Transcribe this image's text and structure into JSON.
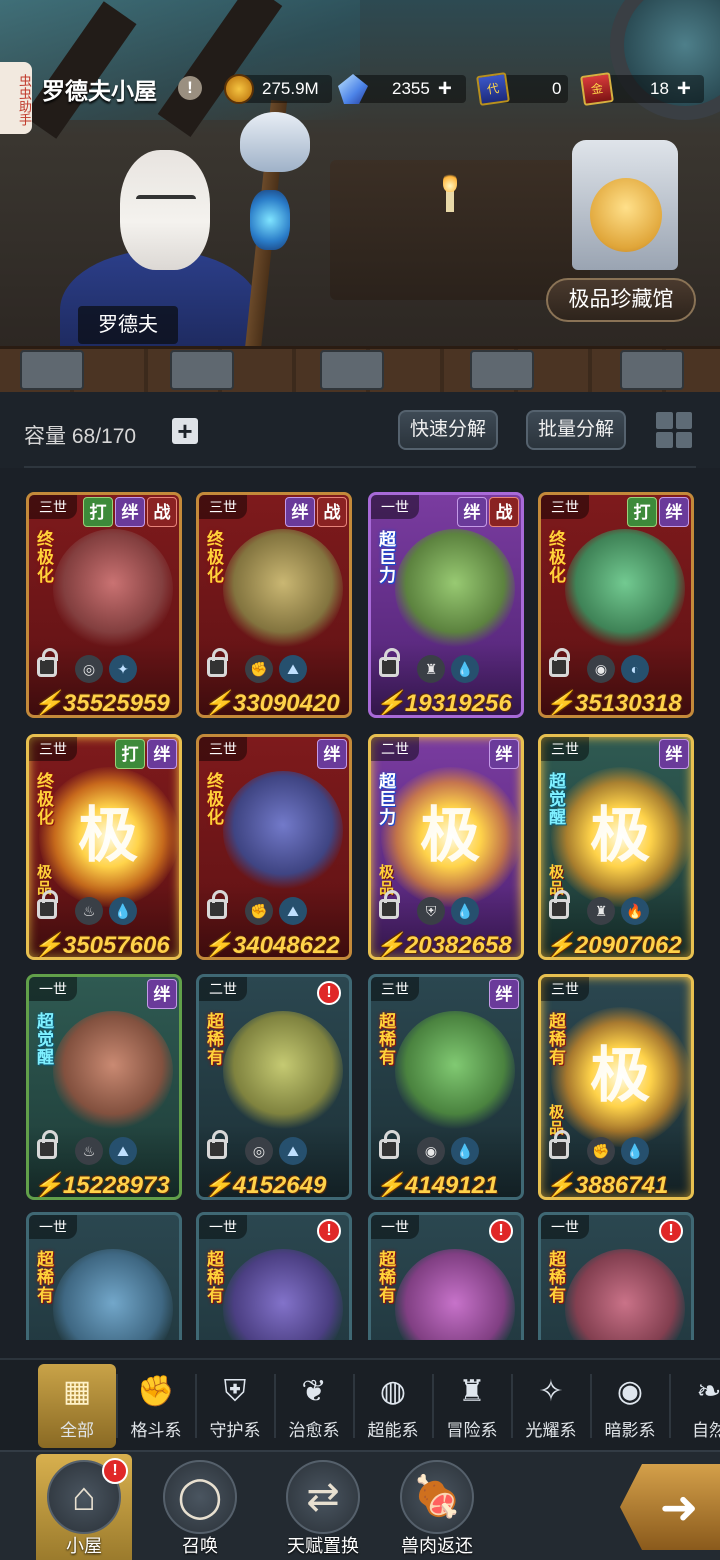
{
  "side_tab": "虫虫助手",
  "header": {
    "title": "罗德夫小屋",
    "info_icon": "!",
    "resources": [
      {
        "icon": "coin-icon",
        "value": "275.9M",
        "plus": false
      },
      {
        "icon": "crystal-icon",
        "value": "2355",
        "plus": true
      },
      {
        "icon": "blue-ticket-icon",
        "ticket_text": "代",
        "value": "0",
        "plus": false
      },
      {
        "icon": "red-ticket-icon",
        "ticket_text": "金",
        "value": "18",
        "plus": true
      }
    ]
  },
  "scene": {
    "npc_name": "罗德夫",
    "collection_button": "极品珍藏馆"
  },
  "storage": {
    "capacity_label": "容量",
    "capacity_value": "68/170",
    "quick_decompose": "快速分解",
    "batch_decompose": "批量分解"
  },
  "cards": [
    {
      "gen": "三世",
      "badges": [
        "打",
        "绊",
        "战"
      ],
      "rarity": "终极化",
      "power": "35525959",
      "elements": [
        "◎",
        "✦"
      ],
      "theme": "red",
      "ji": false,
      "alert": false
    },
    {
      "gen": "三世",
      "badges": [
        "绊",
        "战"
      ],
      "rarity": "终极化",
      "power": "33090420",
      "elements": [
        "✊",
        "⛰"
      ],
      "theme": "red",
      "ji": false,
      "alert": false
    },
    {
      "gen": "一世",
      "badges": [
        "绊",
        "战"
      ],
      "rarity": "超巨力",
      "power": "19319256",
      "elements": [
        "♜",
        "💧"
      ],
      "theme": "purple",
      "ji": false,
      "alert": false
    },
    {
      "gen": "三世",
      "badges": [
        "打",
        "绊"
      ],
      "rarity": "终极化",
      "power": "35130318",
      "elements": [
        "◉",
        "◐"
      ],
      "theme": "red",
      "ji": false,
      "alert": false
    },
    {
      "gen": "三世",
      "badges": [
        "打",
        "绊"
      ],
      "rarity": "终极化",
      "power": "35057606",
      "elements": [
        "♨",
        "💧"
      ],
      "theme": "red",
      "ji": true,
      "alert": false
    },
    {
      "gen": "三世",
      "badges": [
        "绊"
      ],
      "rarity": "终极化",
      "power": "34048622",
      "elements": [
        "✊",
        "⛰"
      ],
      "theme": "red",
      "ji": false,
      "alert": false
    },
    {
      "gen": "二世",
      "badges": [
        "绊"
      ],
      "rarity": "超巨力",
      "power": "20382658",
      "elements": [
        "⛨",
        "💧"
      ],
      "theme": "purple",
      "ji": true,
      "alert": false
    },
    {
      "gen": "三世",
      "badges": [
        "绊"
      ],
      "rarity": "超觉醒",
      "power": "20907062",
      "elements": [
        "♜",
        "🔥"
      ],
      "theme": "green",
      "ji": true,
      "alert": false
    },
    {
      "gen": "一世",
      "badges": [
        "绊"
      ],
      "rarity": "超觉醒",
      "power": "15228973",
      "elements": [
        "♨",
        "⛰"
      ],
      "theme": "green",
      "ji": false,
      "alert": false
    },
    {
      "gen": "二世",
      "badges": [],
      "rarity": "超稀有",
      "power": "4152649",
      "elements": [
        "◎",
        "⛰"
      ],
      "theme": "teal",
      "ji": false,
      "alert": true
    },
    {
      "gen": "三世",
      "badges": [
        "绊"
      ],
      "rarity": "超稀有",
      "power": "4149121",
      "elements": [
        "◉",
        "💧"
      ],
      "theme": "teal",
      "ji": false,
      "alert": false
    },
    {
      "gen": "三世",
      "badges": [],
      "rarity": "超稀有",
      "power": "3886741",
      "elements": [
        "✊",
        "💧"
      ],
      "theme": "teal",
      "ji": true,
      "alert": false
    },
    {
      "gen": "一世",
      "badges": [],
      "rarity": "超稀有",
      "power": "",
      "elements": [],
      "theme": "teal",
      "ji": false,
      "alert": false
    },
    {
      "gen": "一世",
      "badges": [],
      "rarity": "超稀有",
      "power": "",
      "elements": [],
      "theme": "teal",
      "ji": false,
      "alert": true
    },
    {
      "gen": "一世",
      "badges": [],
      "rarity": "超稀有",
      "power": "",
      "elements": [],
      "theme": "teal",
      "ji": false,
      "alert": true
    },
    {
      "gen": "一世",
      "badges": [],
      "rarity": "超稀有",
      "power": "",
      "elements": [],
      "theme": "teal",
      "ji": false,
      "alert": true
    }
  ],
  "ji_char": "极",
  "ji_tag": "极品",
  "alert_mark": "!",
  "categories": [
    {
      "label": "全部",
      "icon": "▦",
      "active": true
    },
    {
      "label": "格斗系",
      "icon": "✊",
      "active": false
    },
    {
      "label": "守护系",
      "icon": "⛨",
      "active": false
    },
    {
      "label": "治愈系",
      "icon": "❦",
      "active": false
    },
    {
      "label": "超能系",
      "icon": "◍",
      "active": false
    },
    {
      "label": "冒险系",
      "icon": "♜",
      "active": false
    },
    {
      "label": "光耀系",
      "icon": "✧",
      "active": false
    },
    {
      "label": "暗影系",
      "icon": "◉",
      "active": false
    },
    {
      "label": "自然",
      "icon": "❧",
      "active": false
    }
  ],
  "bottom_nav": [
    {
      "label": "小屋",
      "icon": "⌂",
      "active": true,
      "alert": true
    },
    {
      "label": "召唤",
      "icon": "◯",
      "active": false,
      "alert": false
    },
    {
      "label": "天赋置换",
      "icon": "⇄",
      "active": false,
      "alert": false
    },
    {
      "label": "兽肉返还",
      "icon": "🍖",
      "active": false,
      "alert": false
    }
  ],
  "next_icon": "➜"
}
